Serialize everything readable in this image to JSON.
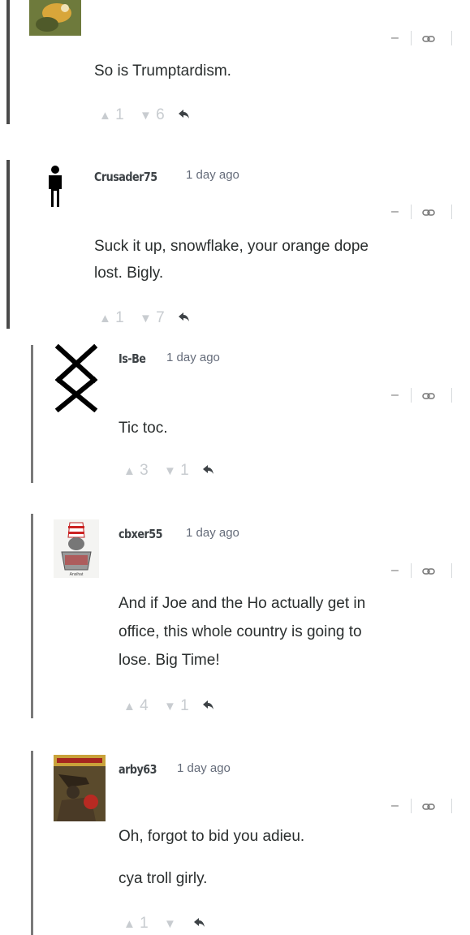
{
  "comments": [
    {
      "author": "",
      "timestamp": "",
      "lines": [
        "So is Trumptardism."
      ],
      "upvotes": "1",
      "downvotes": "6",
      "up_arrow": "▲",
      "down_arrow": "▼"
    },
    {
      "author": "Crusader75",
      "timestamp": "1 day ago",
      "lines": [
        "Suck it up, snowflake, your orange dope",
        "lost. Bigly."
      ],
      "upvotes": "1",
      "downvotes": "7",
      "up_arrow": "▲",
      "down_arrow": "▼"
    },
    {
      "author": "Is-Be",
      "timestamp": "1 day ago",
      "lines": [
        "Tic toc."
      ],
      "upvotes": "3",
      "downvotes": "1",
      "up_arrow": "▲",
      "down_arrow": "▼"
    },
    {
      "author": "cbxer55",
      "timestamp": "1 day ago",
      "lines": [
        "And if Joe and the Ho actually get in",
        "office, this whole country is going to",
        "lose. Big Time!"
      ],
      "upvotes": "4",
      "downvotes": "1",
      "up_arrow": "▲",
      "down_arrow": "▼"
    },
    {
      "author": "arby63",
      "timestamp": "1 day ago",
      "lines": [
        "Oh, forgot to bid you adieu.",
        "cya troll girly."
      ],
      "upvotes": "1",
      "downvotes": "",
      "up_arrow": "▲",
      "down_arrow": "▼"
    }
  ],
  "menu": {
    "collapse": "–"
  },
  "icons": {
    "link": "link-icon",
    "flag": "flag-icon",
    "reply": "reply-icon",
    "upvote": "upvote-arrow-icon",
    "downvote": "downvote-arrow-icon"
  },
  "colors": {
    "thread_bar": "#4a4a4a",
    "author": "#3d4246",
    "meta": "#656c7a",
    "vote": "#c8ccd0"
  }
}
